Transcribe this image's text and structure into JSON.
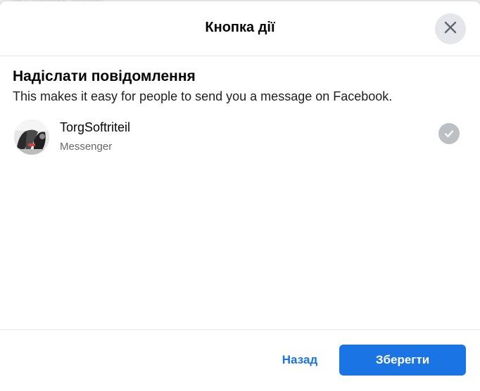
{
  "backdrop": {
    "partial_text": "...ів сторінки Добре"
  },
  "dialog": {
    "title": "Кнопка дії",
    "close_icon": "close-icon"
  },
  "section": {
    "title": "Надіслати повідомлення",
    "description": "This makes it easy for people to send you a message on Facebook."
  },
  "option": {
    "name": "TorgSoftriteil",
    "subtitle": "Messenger",
    "selected": true,
    "check_icon": "checkmark-circle-icon"
  },
  "footer": {
    "back_label": "Назад",
    "save_label": "Зберегти"
  },
  "colors": {
    "accent": "#1b74e4",
    "check_bg": "#bcc0c4",
    "divider": "#e4e6eb"
  }
}
